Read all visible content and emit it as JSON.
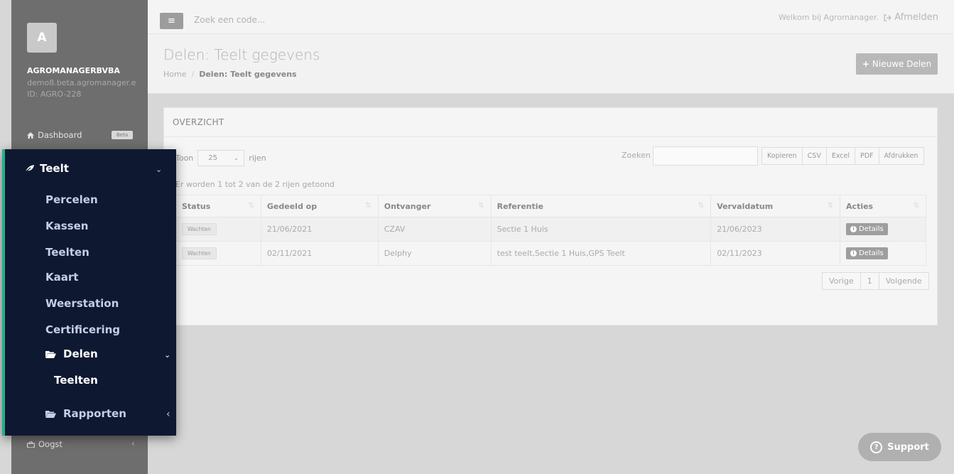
{
  "sidebar": {
    "avatar_letter": "A",
    "company": "AGROMANAGERBVBA",
    "url": "demo8.beta.agromanager.e",
    "id": "ID: AGRO-228",
    "dashboard_label": "Dashboard",
    "beta_badge": "Beta",
    "oogst_label": "Oogst",
    "icons": {
      "dashboard": "home-icon",
      "oogst": "basket-icon"
    }
  },
  "topbar": {
    "search_placeholder": "Zoek een code...",
    "welcome": "Welkom bij Agromanager.",
    "logout": "Afmelden"
  },
  "header": {
    "title": "Delen: Teelt gegevens",
    "breadcrumb": {
      "home": "Home",
      "sep": "/",
      "current": "Delen: Teelt gegevens"
    },
    "new_button": "Nieuwe Delen"
  },
  "panel": {
    "title": "OVERZICHT",
    "toon": "Toon",
    "rows_value": "25",
    "rijen": "rijen",
    "zoeken": "Zoeken",
    "export_buttons": [
      "Kopieren",
      "CSV",
      "Excel",
      "PDF",
      "Afdrukken"
    ],
    "info": "Er worden 1 tot 2 van de 2 rijen getoond",
    "columns": [
      "Status",
      "Gedeeld op",
      "Ontvanger",
      "Referentie",
      "Vervaldatum",
      "Acties"
    ],
    "rows": [
      {
        "status": "Wachten",
        "gedeeld_op": "21/06/2021",
        "ontvanger": "CZAV",
        "referentie": "Sectie 1 Huis",
        "vervaldatum": "21/06/2023",
        "actie": "Details"
      },
      {
        "status": "Wachten",
        "gedeeld_op": "02/11/2021",
        "ontvanger": "Delphy",
        "referentie": "test teelt,Sectie 1 Huis,GPS Teelt",
        "vervaldatum": "02/11/2023",
        "actie": "Details"
      }
    ],
    "pager": {
      "prev": "Vorige",
      "page": "1",
      "next": "Volgende"
    }
  },
  "support": {
    "label": "Support"
  },
  "popout_menu": {
    "teelt": "Teelt",
    "items": [
      "Percelen",
      "Kassen",
      "Teelten",
      "Kaart",
      "Weerstation",
      "Certificering"
    ],
    "delen": "Delen",
    "delen_sub": "Teelten",
    "rapporten": "Rapporten",
    "accent_color": "#21b08c",
    "background_color": "#0f1831"
  }
}
